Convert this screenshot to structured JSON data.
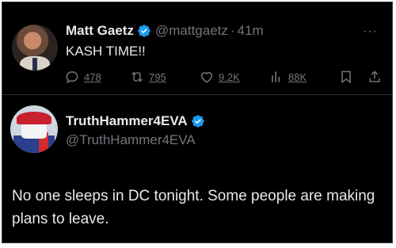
{
  "tweet1": {
    "author_name": "Matt Gaetz",
    "handle": "@mattgaetz",
    "separator": "·",
    "time": "41m",
    "text": "KASH TIME!!",
    "more": "···",
    "actions": {
      "replies": "478",
      "reposts": "795",
      "likes": "9.2K",
      "views": "88K"
    }
  },
  "tweet2": {
    "author_name": "TruthHammer4EVA",
    "handle": "@TruthHammer4EVA",
    "text": "No one sleeps in DC tonight. Some people are making plans to leave."
  },
  "colors": {
    "background": "#000000",
    "text_primary": "#e7e9ea",
    "text_secondary": "#71767b",
    "verified_badge": "#1d9bf0"
  },
  "icons": [
    "verified-badge-icon",
    "more-icon",
    "reply-icon",
    "repost-icon",
    "like-icon",
    "views-icon",
    "bookmark-icon",
    "share-icon"
  ]
}
